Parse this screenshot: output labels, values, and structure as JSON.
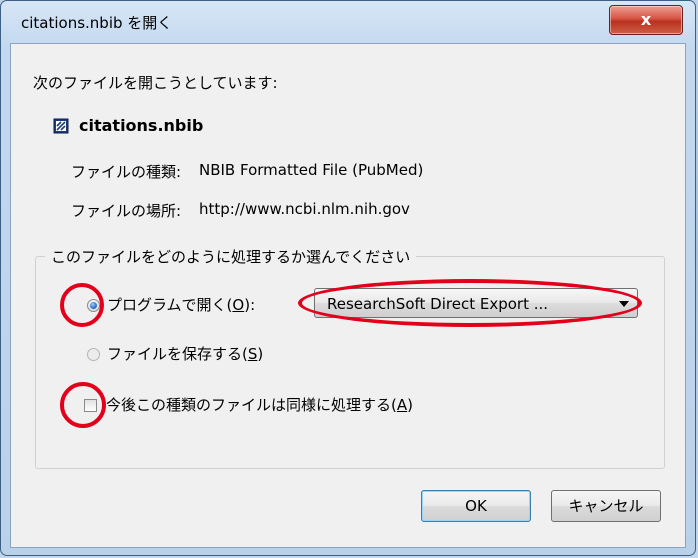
{
  "window": {
    "title": "citations.nbib を開く",
    "close_label": "x",
    "close_icon": "close-icon"
  },
  "prompt": "次のファイルを開こうとしています:",
  "file": {
    "name": "citations.nbib",
    "icon": "nbib-file-icon",
    "type_label": "ファイルの種類:",
    "type_value": "NBIB Formatted File (PubMed)",
    "location_label": "ファイルの場所:",
    "location_value": "http://www.ncbi.nlm.nih.gov"
  },
  "group": {
    "title": "このファイルをどのように処理するか選んでください",
    "open_with": {
      "label": "プログラムで開く(",
      "accel": "O",
      "label_end": "):",
      "selected": true
    },
    "program_select": {
      "value": "ResearchSoft Direct Export ..."
    },
    "save_file": {
      "label": "ファイルを保存する(",
      "accel": "S",
      "label_end": ")",
      "selected": false
    },
    "remember": {
      "label": "今後この種類のファイルは同様に処理する(",
      "accel": "A",
      "label_end": ")",
      "checked": false
    }
  },
  "buttons": {
    "ok": "OK",
    "cancel": "キャンセル"
  },
  "colors": {
    "annotation": "#e3001b",
    "accent": "#2a6fc9",
    "close_red": "#c9432f"
  }
}
